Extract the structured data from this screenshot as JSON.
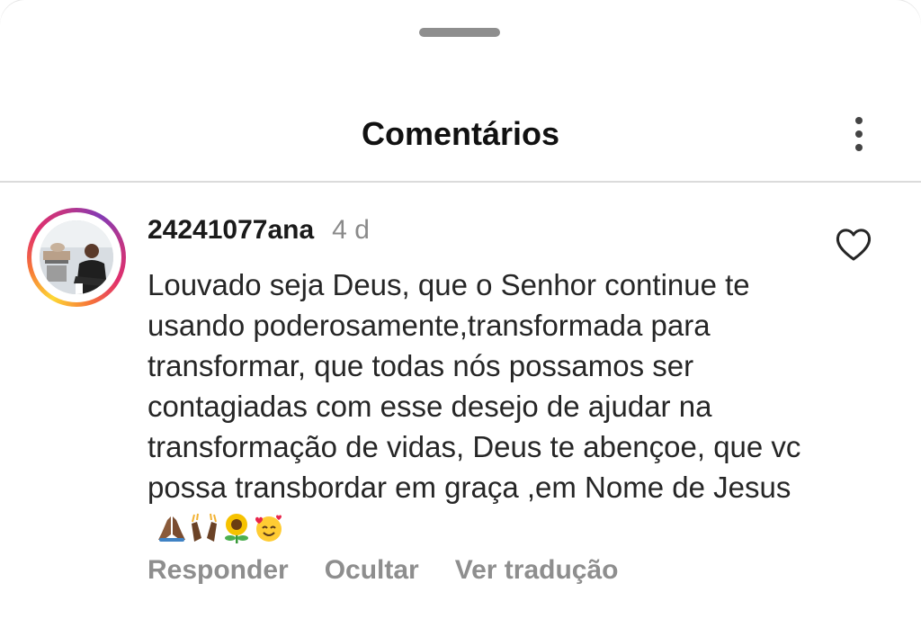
{
  "sheet": {
    "title": "Comentários"
  },
  "comment": {
    "username": "24241077ana",
    "time": "4 d",
    "text": "Louvado seja Deus, que o Senhor continue te usando poderosamente,transformada para transformar, que todas nós possamos ser contagiadas com esse desejo de ajudar na transformação de vidas, Deus te abençoe, que vc possa transbordar em graça ,em Nome de Jesus",
    "emojis": [
      "folded-hands-emoji",
      "raising-hands-emoji",
      "sunflower-emoji",
      "smiling-face-with-hearts-emoji"
    ],
    "actions": {
      "reply": "Responder",
      "hide": "Ocultar",
      "translate": "Ver tradução"
    }
  },
  "icons": {
    "more": "more-vertical-icon",
    "like": "heart-outline-icon"
  },
  "colors": {
    "secondary_text": "#8e8e8e",
    "divider": "#dbdbdb"
  }
}
